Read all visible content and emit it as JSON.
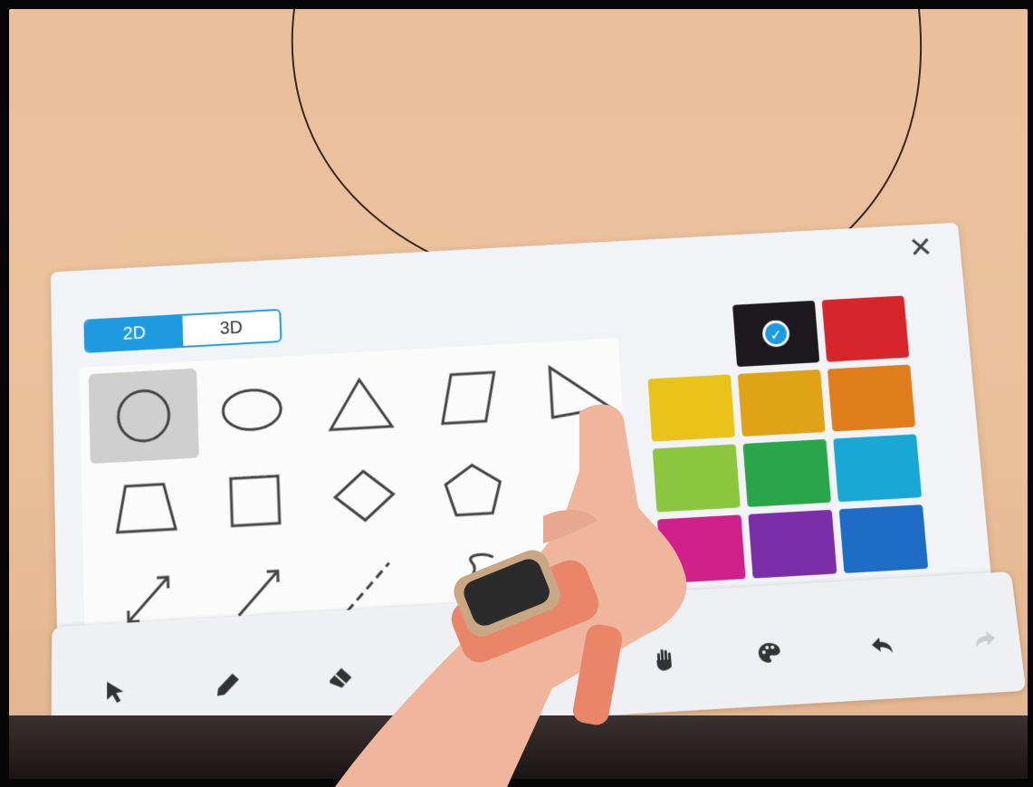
{
  "panel": {
    "close_label": "✕",
    "tabs": [
      {
        "label": "2D",
        "active": true
      },
      {
        "label": "3D",
        "active": false
      }
    ],
    "shapes": [
      {
        "name": "circle-icon",
        "selected": true
      },
      {
        "name": "ellipse-icon",
        "selected": false
      },
      {
        "name": "triangle-icon",
        "selected": false
      },
      {
        "name": "parallelogram-icon",
        "selected": false
      },
      {
        "name": "right-triangle-icon",
        "selected": false
      },
      {
        "name": "trapezoid-icon",
        "selected": false
      },
      {
        "name": "square-icon",
        "selected": false
      },
      {
        "name": "rhombus-icon",
        "selected": false
      },
      {
        "name": "pentagon-icon",
        "selected": false
      },
      {
        "name": "double-arrow-line-icon",
        "selected": false
      },
      {
        "name": "arrow-line-icon",
        "selected": false
      },
      {
        "name": "dashed-line-icon",
        "selected": false
      },
      {
        "name": "curve-icon",
        "selected": false
      }
    ],
    "colors": [
      {
        "hex": "#1c1a1f",
        "selected": true
      },
      {
        "hex": "#d7262b",
        "selected": false
      },
      {
        "hex": "#e9c21a",
        "selected": false
      },
      {
        "hex": "#e0a318",
        "selected": false
      },
      {
        "hex": "#e07d1b",
        "selected": false
      },
      {
        "hex": "#8cc63e",
        "selected": false
      },
      {
        "hex": "#2aa64a",
        "selected": false
      },
      {
        "hex": "#19a8d6",
        "selected": false
      },
      {
        "hex": "#d0208a",
        "selected": false
      },
      {
        "hex": "#7a2fa8",
        "selected": false
      },
      {
        "hex": "#1f6cc7",
        "selected": false
      }
    ]
  },
  "toolbar": {
    "tools": [
      {
        "name": "select-arrow-icon"
      },
      {
        "name": "pen-icon"
      },
      {
        "name": "eraser-icon"
      },
      {
        "name": "trash-icon"
      },
      {
        "name": "hand-icon"
      },
      {
        "name": "palette-icon"
      },
      {
        "name": "undo-icon"
      },
      {
        "name": "redo-icon"
      }
    ]
  }
}
